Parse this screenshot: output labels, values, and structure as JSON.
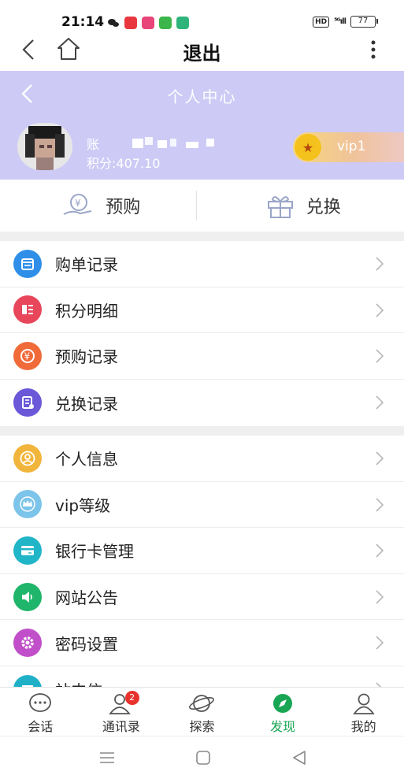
{
  "status_bar": {
    "time": "21:14",
    "battery": "77"
  },
  "nav": {
    "title": "退出"
  },
  "header": {
    "title": "个人中心",
    "account_label": "账",
    "points": "积分:407.10",
    "vip": "vip1"
  },
  "actions": [
    {
      "label": "预购",
      "icon": "coin-hand-icon"
    },
    {
      "label": "兑换",
      "icon": "gift-icon"
    }
  ],
  "menu_group_1": [
    {
      "label": "购单记录",
      "icon": "calendar-icon",
      "color": "#2f8fe8"
    },
    {
      "label": "积分明细",
      "icon": "list-icon",
      "color": "#e8465b"
    },
    {
      "label": "预购记录",
      "icon": "yen-icon",
      "color": "#f06a3a"
    },
    {
      "label": "兑换记录",
      "icon": "document-icon",
      "color": "#6a58d8"
    }
  ],
  "menu_group_2": [
    {
      "label": "个人信息",
      "icon": "person-icon",
      "color": "#f2b53b"
    },
    {
      "label": "vip等级",
      "icon": "crown-icon",
      "color": "#7cc4ea"
    },
    {
      "label": "银行卡管理",
      "icon": "card-icon",
      "color": "#21b5c8"
    },
    {
      "label": "网站公告",
      "icon": "speaker-icon",
      "color": "#1fb56b"
    },
    {
      "label": "密码设置",
      "icon": "gear-icon",
      "color": "#c04fc9"
    },
    {
      "label": "站内信",
      "icon": "mail-icon",
      "color": "#1fb0c8"
    }
  ],
  "tabs": [
    {
      "label": "会话",
      "icon": "chat-icon"
    },
    {
      "label": "通讯录",
      "icon": "contacts-icon",
      "badge": "2"
    },
    {
      "label": "探索",
      "icon": "planet-icon"
    },
    {
      "label": "发现",
      "icon": "compass-icon"
    },
    {
      "label": "我的",
      "icon": "profile-icon"
    }
  ],
  "colors": {
    "header_bg": "#cdcaf6",
    "active_tab": "#19a654",
    "vip_star": "#f4c21c"
  }
}
